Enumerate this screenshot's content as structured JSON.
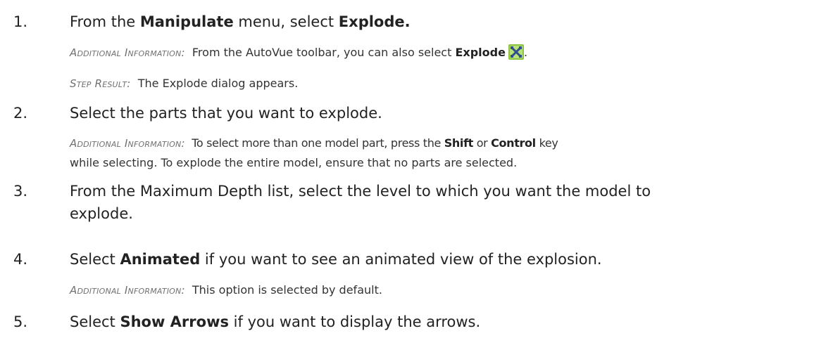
{
  "steps": [
    {
      "number": "1.",
      "text": {
        "a": "From the ",
        "b": "Manipulate",
        "c": " menu, select ",
        "d": "Explode."
      },
      "additional": {
        "label": "Additional Information:",
        "a": "From the AutoVue toolbar, you can also select ",
        "b": "Explode",
        "c": ".",
        "icon": "explode-tool-icon"
      },
      "result": {
        "label": "Step Result:",
        "text": "The Explode dialog appears."
      }
    },
    {
      "number": "2.",
      "text": "Select the parts that you want to explode.",
      "additional": {
        "label": "Additional Information:",
        "a": "To select more than one model part, press the ",
        "b": "Shift",
        "c": " or ",
        "d": "Control",
        "e": " key",
        "f": "while selecting. To explode the entire model, ensure that no parts are selected."
      }
    },
    {
      "number": "3.",
      "line1": "From the Maximum Depth list, select the level to which you want the model to",
      "line2": "explode."
    },
    {
      "number": "4.",
      "text": {
        "a": "Select ",
        "b": "Animated",
        "c": " if you want to see an animated view of the explosion."
      },
      "additional": {
        "label": "Additional Information:",
        "text": "This option is selected by default."
      }
    },
    {
      "number": "5.",
      "text": {
        "a": "Select ",
        "b": "Show Arrows",
        "c": " if you want to display the arrows."
      }
    }
  ],
  "colors": {
    "icon_bg": "#8ac43f",
    "icon_mark": "#2e4f8a",
    "label": "#707070"
  }
}
